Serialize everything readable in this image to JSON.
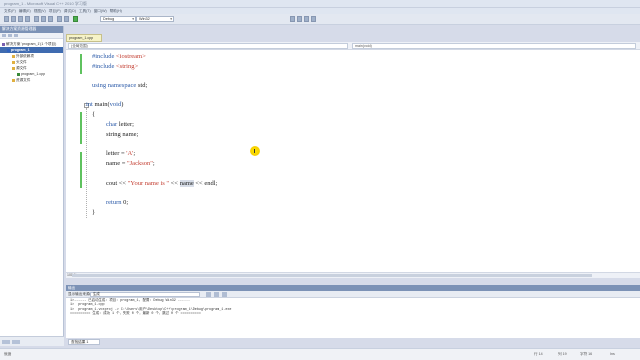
{
  "window": {
    "title": "program_1 - Microsoft Visual C++ 2010 学习版"
  },
  "menu": [
    "文件(F)",
    "编辑(E)",
    "视图(V)",
    "项目(P)",
    "调试(D)",
    "工具(T)",
    "窗口(W)",
    "帮助(H)"
  ],
  "toolbar": {
    "config": "Debug",
    "platform": "Win32"
  },
  "solution_explorer": {
    "title": "解决方案资源管理器",
    "items": [
      {
        "label": "解决方案 'program_1'(1 个项目)",
        "indent": 0,
        "selected": false,
        "icon_color": "#7a5fb0"
      },
      {
        "label": "program_1",
        "indent": 1,
        "selected": true,
        "icon_color": "#2f62c0"
      },
      {
        "label": "外部依赖项",
        "indent": 2,
        "selected": false,
        "icon_color": "#e0b040"
      },
      {
        "label": "头文件",
        "indent": 2,
        "selected": false,
        "icon_color": "#e0b040"
      },
      {
        "label": "源文件",
        "indent": 2,
        "selected": false,
        "icon_color": "#e0b040"
      },
      {
        "label": "program_1.cpp",
        "indent": 3,
        "selected": false,
        "icon_color": "#3a8a3a"
      },
      {
        "label": "资源文件",
        "indent": 2,
        "selected": false,
        "icon_color": "#e0b040"
      }
    ]
  },
  "editor": {
    "tab": "program_1.cpp",
    "nav_left": "(全局范围)",
    "nav_right": "main(void)",
    "zoom": "100 %",
    "lines": [
      [
        {
          "t": "#include ",
          "c": "kw"
        },
        {
          "t": "<iostream>",
          "c": "str"
        }
      ],
      [
        {
          "t": "#include ",
          "c": "kw"
        },
        {
          "t": "<string>",
          "c": "str"
        }
      ],
      [
        {
          "t": "using namespace ",
          "c": "kw"
        },
        {
          "t": "std;",
          "c": "plain"
        }
      ],
      [
        {
          "t": "int ",
          "c": "kw"
        },
        {
          "t": "main(",
          "c": "plain"
        },
        {
          "t": "void",
          "c": "kw"
        },
        {
          "t": ")",
          "c": "plain"
        }
      ],
      [
        {
          "t": "{",
          "c": "plain"
        }
      ],
      [
        {
          "t": "char ",
          "c": "kw"
        },
        {
          "t": "letter;",
          "c": "plain"
        }
      ],
      [
        {
          "t": "string name;",
          "c": "plain"
        }
      ],
      [
        {
          "t": "letter = ",
          "c": "plain"
        },
        {
          "t": "'A'",
          "c": "str"
        },
        {
          "t": ";",
          "c": "plain"
        }
      ],
      [
        {
          "t": "name = ",
          "c": "plain"
        },
        {
          "t": "\"Jackson\"",
          "c": "str"
        },
        {
          "t": ";",
          "c": "plain"
        }
      ],
      [
        {
          "t": "cout << ",
          "c": "plain"
        },
        {
          "t": "\"Your name is \"",
          "c": "str"
        },
        {
          "t": " << ",
          "c": "plain"
        },
        {
          "t": "name",
          "c": "hl"
        },
        {
          "t": " << endl;",
          "c": "plain"
        }
      ],
      [
        {
          "t": "return ",
          "c": "kw"
        },
        {
          "t": "0;",
          "c": "plain"
        }
      ],
      [
        {
          "t": "}",
          "c": "plain"
        }
      ]
    ]
  },
  "output": {
    "title": "输出",
    "show_from_label": "显示输出来源(S):",
    "show_from": "生成",
    "lines": [
      "1>------ 已启动生成: 项目: program_1, 配置: Debug Win32 ------",
      "1>  program_1.cpp",
      "1>  program_1.vcxproj -> C:\\Users\\用户\\Desktop\\C++\\program_1\\Debug\\program_1.exe",
      "========== 生成: 成功 1 个，失败 0 个，最新 0 个，跳过 0 个 =========="
    ],
    "tab": "查找结果 1"
  },
  "status": {
    "left": "就绪",
    "line": "行 14",
    "col": "列 19",
    "ch": "字符 16",
    "mode": "Ins"
  }
}
